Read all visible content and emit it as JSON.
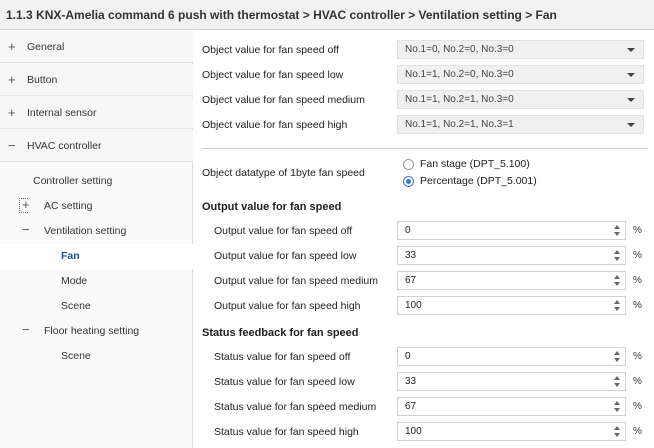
{
  "title": "1.1.3 KNX-Amelia command 6 push with thermostat > HVAC controller > Ventilation setting > Fan",
  "sidebar": {
    "top": [
      {
        "sign": "+",
        "label": "General"
      },
      {
        "sign": "+",
        "label": "Button"
      },
      {
        "sign": "+",
        "label": "Internal sensor"
      },
      {
        "sign": "−",
        "label": "HVAC controller"
      }
    ],
    "sub": [
      {
        "sign": "",
        "label": "Controller setting"
      },
      {
        "sign": "+",
        "label": "AC setting"
      },
      {
        "sign": "−",
        "label": "Ventilation setting"
      },
      {
        "sign": "",
        "label": "Fan"
      },
      {
        "sign": "",
        "label": "Mode"
      },
      {
        "sign": "",
        "label": "Scene"
      },
      {
        "sign": "−",
        "label": "Floor heating setting"
      },
      {
        "sign": "",
        "label": "Scene"
      }
    ]
  },
  "object_values": [
    {
      "label": "Object value for fan speed off",
      "value": "No.1=0, No.2=0, No.3=0"
    },
    {
      "label": "Object value for fan speed low",
      "value": "No.1=1, No.2=0, No.3=0"
    },
    {
      "label": "Object value for fan speed medium",
      "value": "No.1=1, No.2=1, No.3=0"
    },
    {
      "label": "Object value for fan speed high",
      "value": "No.1=1, No.2=1, No.3=1"
    }
  ],
  "datatype": {
    "label": "Object datatype of 1byte fan speed",
    "options": [
      "Fan stage (DPT_5.100)",
      "Percentage (DPT_5.001)"
    ],
    "selected": "Percentage (DPT_5.001)"
  },
  "output_section": {
    "title": "Output value for fan speed",
    "unit": "%",
    "rows": [
      {
        "label": "Output value for fan speed off",
        "value": "0"
      },
      {
        "label": "Output value for fan speed low",
        "value": "33"
      },
      {
        "label": "Output value for fan speed medium",
        "value": "67"
      },
      {
        "label": "Output value for fan speed high",
        "value": "100"
      }
    ]
  },
  "status_section": {
    "title": "Status feedback for fan speed",
    "unit": "%",
    "rows": [
      {
        "label": "Status value for fan speed off",
        "value": "0"
      },
      {
        "label": "Status value for fan speed low",
        "value": "33"
      },
      {
        "label": "Status value for fan speed medium",
        "value": "67"
      },
      {
        "label": "Status value for fan speed high",
        "value": "100"
      }
    ]
  }
}
